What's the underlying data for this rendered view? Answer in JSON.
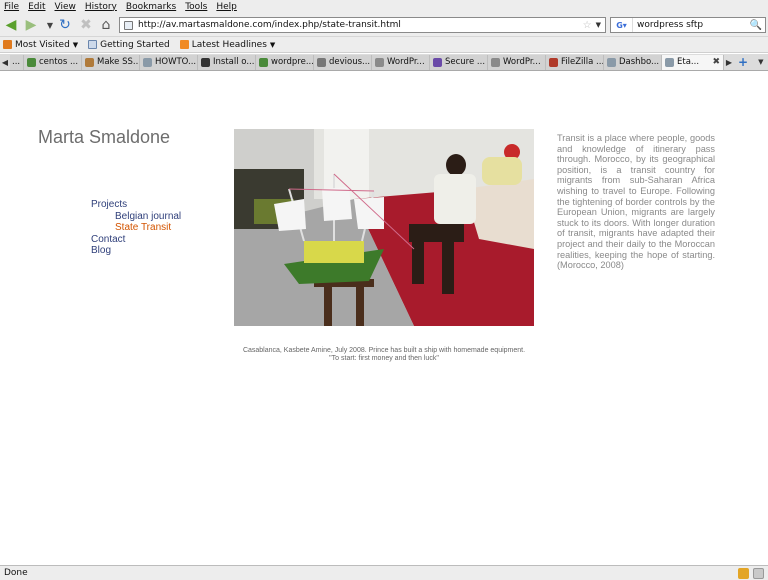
{
  "menu": [
    "File",
    "Edit",
    "View",
    "History",
    "Bookmarks",
    "Tools",
    "Help"
  ],
  "url": "http://av.martasmaldone.com/index.php/state-transit.html",
  "search": {
    "value": "wordpress sftp"
  },
  "bookmarks": [
    {
      "label": "Most Visited",
      "dropdown": true,
      "icon": "orange"
    },
    {
      "label": "Getting Started",
      "dropdown": false,
      "icon": "blue"
    },
    {
      "label": "Latest Headlines",
      "dropdown": true,
      "icon": "rss"
    }
  ],
  "tabs": [
    {
      "label": "centos ...",
      "icon_color": "#4a8a3a"
    },
    {
      "label": "Make SS...",
      "icon_color": "#b07a3a"
    },
    {
      "label": "HOWTO...",
      "icon_color": "#8a9aa8"
    },
    {
      "label": "Install o...",
      "icon_color": "#333333"
    },
    {
      "label": "wordpre...",
      "icon_color": "#4a8a3a"
    },
    {
      "label": "devious...",
      "icon_color": "#777777"
    },
    {
      "label": "WordPr...",
      "icon_color": "#8a8a8a"
    },
    {
      "label": "Secure ...",
      "icon_color": "#6a4aa8"
    },
    {
      "label": "WordPr...",
      "icon_color": "#8a8a8a"
    },
    {
      "label": "FileZilla ...",
      "icon_color": "#b03a2a"
    },
    {
      "label": "Dashbo...",
      "icon_color": "#8a9aa8"
    },
    {
      "label": "Eta...",
      "icon_color": "#8a9aa8",
      "active": true
    }
  ],
  "site": {
    "title": "Marta Smaldone",
    "nav": {
      "projects": "Projects",
      "belgian_journal": "Belgian journal",
      "state_transit": "State Transit",
      "contact": "Contact",
      "blog": "Blog"
    },
    "caption_line1": "Casablanca, Kasbete Amine, July 2008. Prince has built a ship with homemade equipment.",
    "caption_line2": "\"To start: first money and then luck\"",
    "description": "Transit is a place where people, goods and knowledge of itinerary pass through. Morocco, by its geographical position, is a transit country for migrants from sub-Saharan Africa wishing to travel to Europe. Following the tightening of border controls by the European Union, migrants are largely stuck to its doors. With longer duration of transit, migrants have adapted their project and their daily to the Moroccan realities, keeping the hope of starting. (Morocco, 2008)"
  },
  "status": "Done"
}
